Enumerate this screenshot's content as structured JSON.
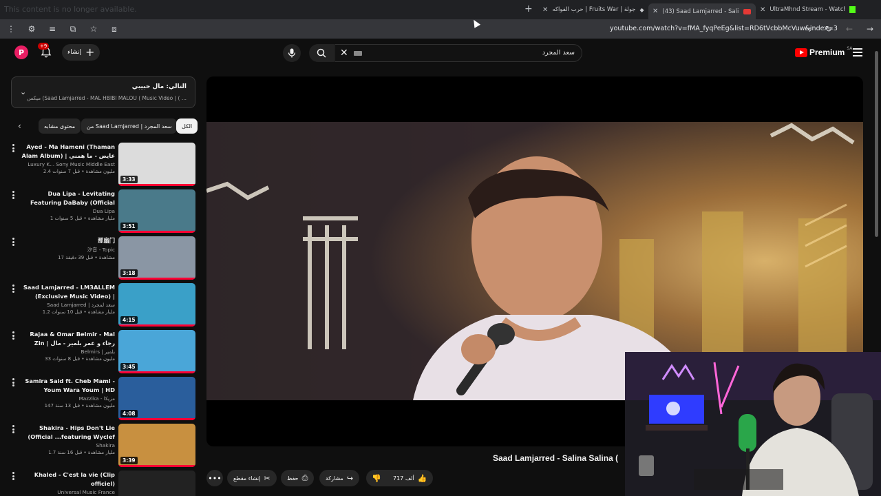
{
  "browser": {
    "ghost_text": "This content is no longer available.",
    "tabs": [
      {
        "label": "UltraMhnd Stream - Watch Live",
        "icon": "kick-icon"
      },
      {
        "label": "(43) Saad Lamjarred - Salina Sa",
        "icon": "record-icon",
        "active": true
      },
      {
        "label": "حرب الفواكه | Fruits War | جولة",
        "icon": "game-icon"
      }
    ],
    "url": "youtube.com/watch?v=fMA_fyqPeEg&list=RD6tVcbbMcVuw&index=3"
  },
  "header": {
    "avatar_letter": "P",
    "notifications": "+9",
    "create_label": "إنشاء",
    "search_value": "سعد المجرد",
    "logo_text": "Premium",
    "logo_region": "SA"
  },
  "playlist_panel": {
    "next_label": "التالي: مال حبيبي",
    "subtitle": "ميكس (Saad Lamjarred - MAL HBIBI MALOU ( Music Video | ( ..."
  },
  "chips": [
    {
      "label": "الكل",
      "active": true
    },
    {
      "label": "من Saad Lamjarred | سعد المجرد",
      "active": false
    },
    {
      "label": "محتوى مشابه",
      "active": false
    }
  ],
  "related": [
    {
      "title": "Ayed - Ma Hameni (Thaman Alam Album) | عايض - ما همني (من...",
      "channel": "Luxury K... Sony Music Middle East",
      "meta": "2.4 مليون مشاهدة • قبل 7 سنوات",
      "duration": "3:33",
      "bg": "#dcdcdc"
    },
    {
      "title": "Dua Lipa - Levitating Featuring DaBaby (Official Music Video)",
      "channel": "Dua Lipa",
      "meta": "1 مليار مشاهدة • قبل 5 سنوات",
      "duration": "3:51",
      "bg": "#4a7a8a"
    },
    {
      "title": "那扇门",
      "channel": "汐音 - Topic",
      "meta": "17 مشاهدة • قبل 39 دقيقة",
      "duration": "3:18",
      "bg": "#8a96a4"
    },
    {
      "title": "Saad Lamjarred - LM3ALLEM (Exclusive Music Video) | سعد...",
      "channel": "Saad Lamjarred | سعد لمجرد",
      "meta": "1.2 مليار مشاهدة • قبل 10 سنوات",
      "duration": "4:15",
      "bg": "#3aa0c8"
    },
    {
      "title": "Rajaa & Omar Belmir - Mal Zin | رجاء و عمر بلمير - مال الزين",
      "channel": "Belmirs | بلمير",
      "meta": "33 مليون مشاهدة • قبل 8 سنوات",
      "duration": "3:45",
      "bg": "#4aa6d8"
    },
    {
      "title": "Samira Said ft. Cheb Mami - Youm Wara Youm | HD Version |...",
      "channel": "Mazzika - مزيكا",
      "meta": "147 مليون مشاهدة • قبل 13 سنة",
      "duration": "4:08",
      "bg": "#2a5e9c"
    },
    {
      "title": "Shakira - Hips Don't Lie (Official ...featuring Wyclef Jean)",
      "channel": "Shakira",
      "meta": "1.7 مليار مشاهدة • قبل 16 سنة",
      "duration": "3:39",
      "bg": "#c89040"
    },
    {
      "title": "Khaled - C'est la vie (Clip officiel)",
      "channel": "Universal Music France",
      "meta": "",
      "duration": "",
      "bg": "#222"
    }
  ],
  "video": {
    "title": "Saad Lamjarred - Salina Salina (",
    "likes": "717 ألف",
    "share_label": "مشاركة",
    "save_label": "حفظ",
    "clip_label": "إنشاء مقطع"
  }
}
